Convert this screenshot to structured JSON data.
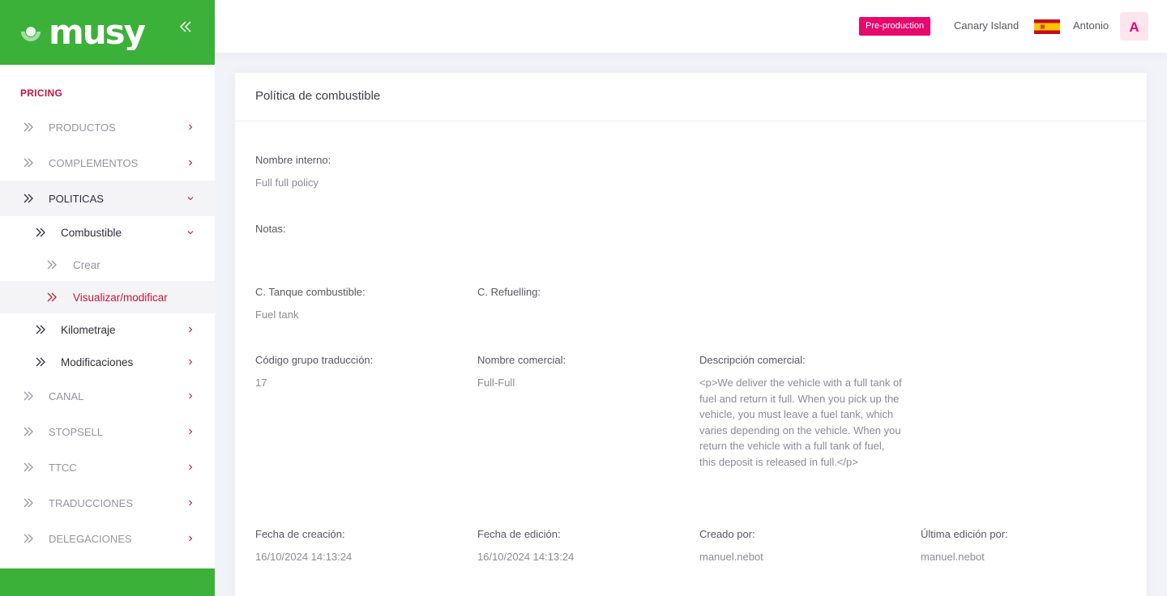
{
  "app": {
    "logo_text": "musy",
    "env_badge": "Pre-production",
    "region": "Canary Island",
    "region_flag": "spain-flag-icon",
    "user_name": "Antonio",
    "user_initial": "A",
    "brand_color": "#3bb13a",
    "accent_color": "#c4173f",
    "badge_color": "#e6086c"
  },
  "sidebar": {
    "section_title": "PRICING",
    "items": [
      {
        "label": "PRODUCTOS",
        "expanded": false
      },
      {
        "label": "COMPLEMENTOS",
        "expanded": false
      },
      {
        "label": "POLITICAS",
        "expanded": true
      },
      {
        "label": "Combustible",
        "expanded": true
      },
      {
        "label": "Crear"
      },
      {
        "label": "Visualizar/modificar",
        "selected": true
      },
      {
        "label": "Kilometraje",
        "expanded": false
      },
      {
        "label": "Modificaciones",
        "expanded": false
      },
      {
        "label": "CANAL",
        "expanded": false
      },
      {
        "label": "STOPSELL",
        "expanded": false
      },
      {
        "label": "TTCC",
        "expanded": false
      },
      {
        "label": "TRADUCCIONES",
        "expanded": false
      },
      {
        "label": "DELEGACIONES",
        "expanded": false
      }
    ]
  },
  "main": {
    "title": "Política de combustible",
    "fields": {
      "nombre_interno": {
        "label": "Nombre interno:",
        "value": "Full full policy"
      },
      "notas": {
        "label": "Notas:",
        "value": ""
      },
      "tanque": {
        "label": "C. Tanque combustible:",
        "value": "Fuel tank"
      },
      "refuelling": {
        "label": "C. Refuelling:",
        "value": ""
      },
      "codigo": {
        "label": "Código grupo traducción:",
        "value": "17"
      },
      "nombre_comercial": {
        "label": "Nombre comercial:",
        "value": "Full-Full"
      },
      "descripcion": {
        "label": "Descripción comercial:",
        "value": "<p>We deliver the vehicle with a full tank of fuel and return it full. When you pick up the vehicle, you must leave a fuel tank, which varies depending on the vehicle. When you return the vehicle with a full tank of fuel, this deposit is released in full.</p>"
      },
      "fecha_creacion": {
        "label": "Fecha de creación:",
        "value": "16/10/2024 14:13:24"
      },
      "fecha_edicion": {
        "label": "Fecha de edición:",
        "value": "16/10/2024 14:13:24"
      },
      "creado_por": {
        "label": "Creado por:",
        "value": "manuel.nebot"
      },
      "ultima_edicion": {
        "label": "Última edición por:",
        "value": "manuel.nebot"
      }
    }
  }
}
